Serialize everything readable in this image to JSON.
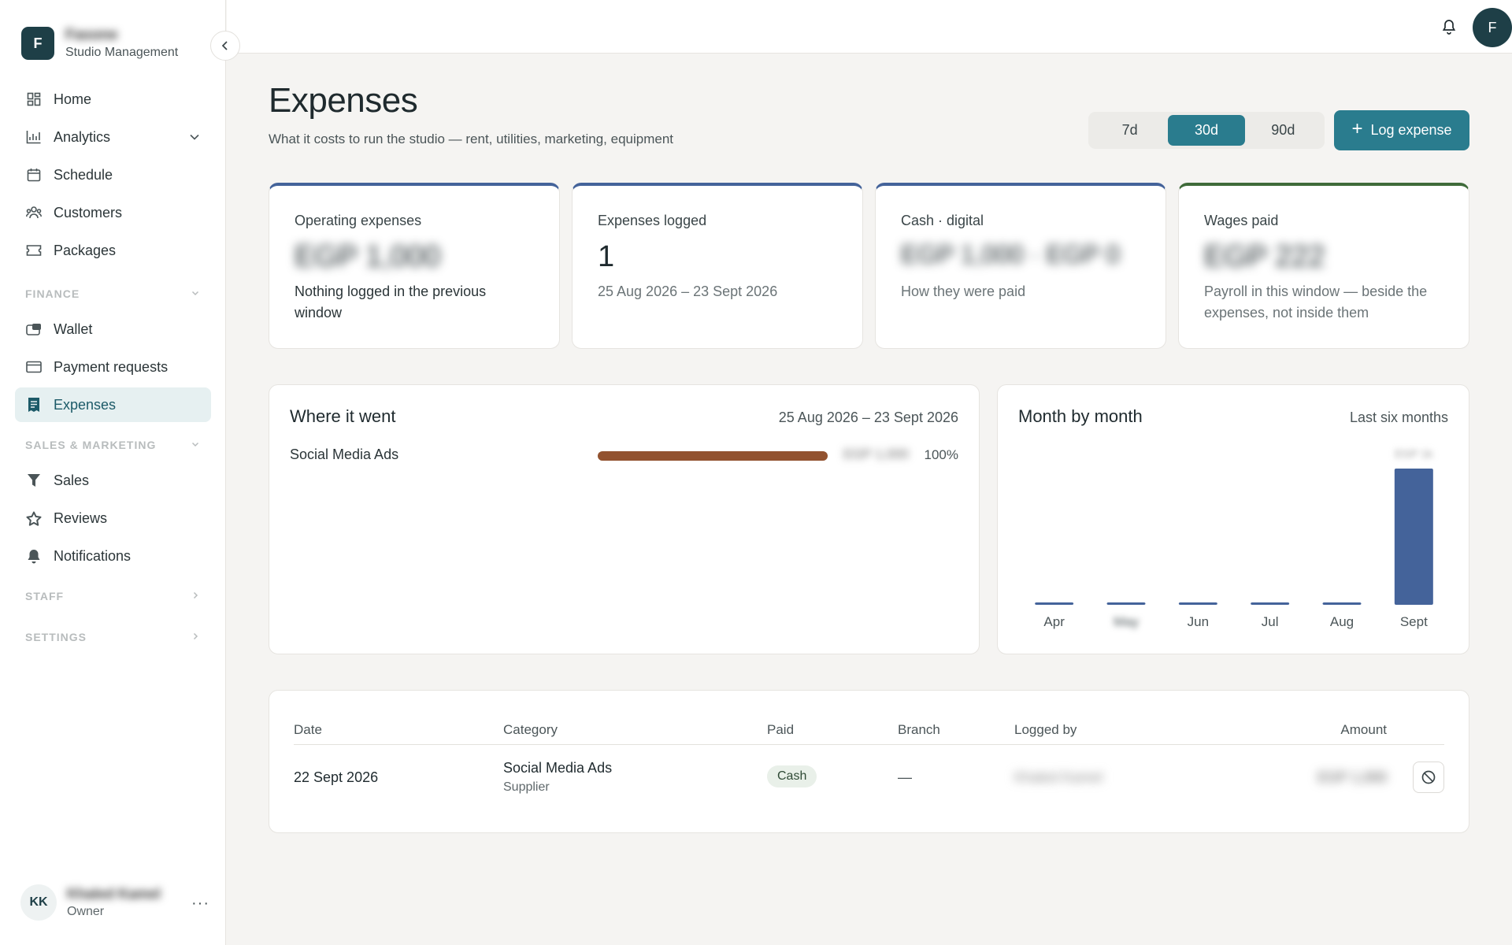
{
  "brand": {
    "logo_letter": "F",
    "name": "Fasone",
    "subtitle": "Studio Management"
  },
  "sidebar": {
    "main_items": [
      {
        "label": "Home",
        "icon": "home-grid-icon"
      },
      {
        "label": "Analytics",
        "icon": "analytics-chart-icon"
      },
      {
        "label": "Schedule",
        "icon": "calendar-icon"
      },
      {
        "label": "Customers",
        "icon": "users-icon"
      },
      {
        "label": "Packages",
        "icon": "ticket-icon"
      }
    ],
    "finance": {
      "title": "FINANCE",
      "items": [
        {
          "label": "Wallet",
          "icon": "wallet-icon"
        },
        {
          "label": "Payment requests",
          "icon": "card-icon"
        },
        {
          "label": "Expenses",
          "icon": "receipt-icon",
          "active": true
        }
      ]
    },
    "sales_marketing": {
      "title": "SALES & MARKETING",
      "items": [
        {
          "label": "Sales",
          "icon": "funnel-icon"
        },
        {
          "label": "Reviews",
          "icon": "star-icon"
        },
        {
          "label": "Notifications",
          "icon": "bell-icon"
        }
      ]
    },
    "staff_title": "STAFF",
    "settings_title": "SETTINGS"
  },
  "user": {
    "initials": "KK",
    "name": "Khaled Kamel",
    "role": "Owner"
  },
  "topbar": {
    "avatar_letter": "F"
  },
  "header": {
    "title": "Expenses",
    "subtitle": "What it costs to run the studio — rent, utilities, marketing, equipment",
    "ranges": [
      "7d",
      "30d",
      "90d"
    ],
    "active_range": "30d",
    "log_button": "Log expense"
  },
  "stats": [
    {
      "label": "Operating expenses",
      "value": "EGP 1,000",
      "note": "Nothing logged in the previous window"
    },
    {
      "label": "Expenses logged",
      "value": "1",
      "note": "25 Aug 2026 – 23 Sept 2026"
    },
    {
      "label": "Cash · digital",
      "value": "EGP 1,000 · EGP 0",
      "note": "How they were paid"
    },
    {
      "label": "Wages paid",
      "value": "EGP 222",
      "note": "Payroll in this window — beside the expenses, not inside them"
    }
  ],
  "where_it_went": {
    "title": "Where it went",
    "range": "25 Aug 2026 – 23 Sept 2026",
    "rows": [
      {
        "label": "Social Media Ads",
        "amount": "EGP 1,000",
        "percent_label": "100%",
        "fraction": 1.0
      }
    ]
  },
  "chart_data": {
    "type": "bar",
    "title": "Month by month",
    "subtitle": "Last six months",
    "categories": [
      "Apr",
      "May",
      "Jun",
      "Jul",
      "Aug",
      "Sept"
    ],
    "values": [
      0,
      0,
      0,
      0,
      0,
      1000
    ],
    "data_labels": [
      "",
      "",
      "",
      "",
      "",
      "EGP 1k"
    ],
    "ylim": [
      0,
      1000
    ],
    "bar_color": "#44639a",
    "grid": false
  },
  "table": {
    "headers": [
      "Date",
      "Category",
      "Paid",
      "Branch",
      "Logged by",
      "Amount"
    ],
    "rows": [
      {
        "date": "22 Sept 2026",
        "category": "Social Media Ads",
        "category_sub": "Supplier",
        "paid": "Cash",
        "branch": "—",
        "logged_by": "Khaled Kamel",
        "amount": "EGP 1,000"
      }
    ]
  },
  "colors": {
    "accent": "#2a7c8e",
    "brand_dark": "#1e3f47",
    "bar_blue": "#44639a",
    "bar_brown": "#92522f"
  }
}
